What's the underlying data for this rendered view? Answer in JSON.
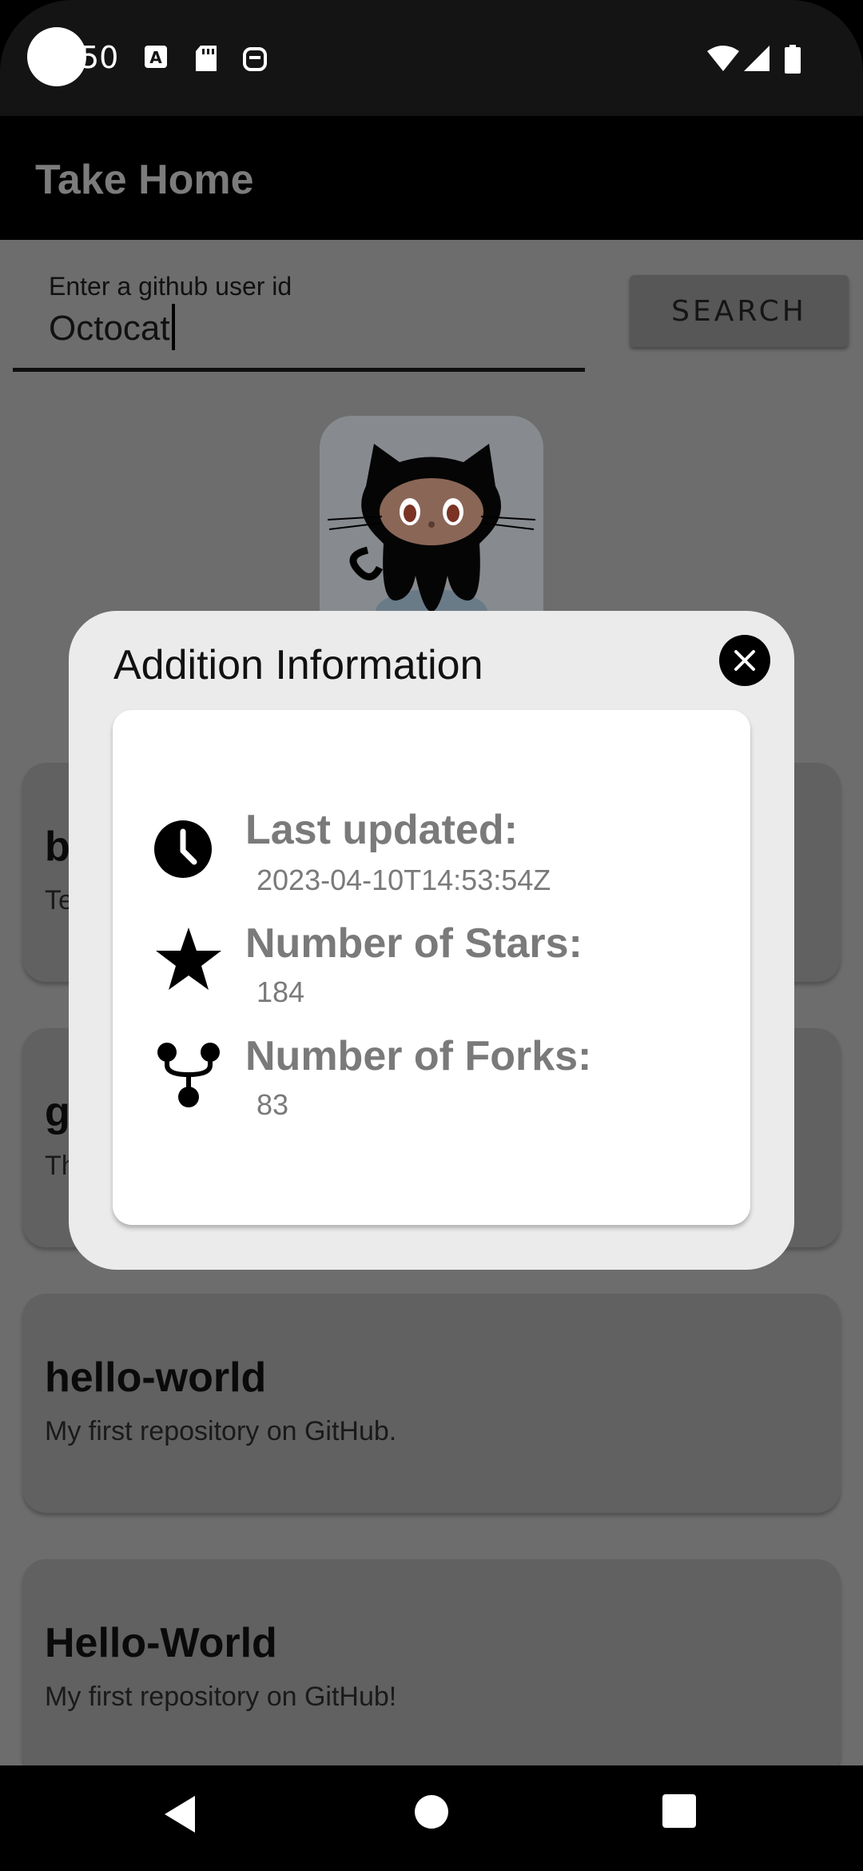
{
  "status_bar": {
    "time": "50",
    "icons": [
      "text-a-icon",
      "sd-card-icon",
      "vpn-icon",
      "wifi-icon",
      "cellular-icon",
      "battery-icon"
    ]
  },
  "app_bar": {
    "title": "Take Home"
  },
  "search": {
    "label": "Enter a github user id",
    "value": "Octocat",
    "button_label": "SEARCH"
  },
  "repos": [
    {
      "name": "b",
      "description": "Te"
    },
    {
      "name": "g",
      "description": "Th"
    },
    {
      "name": "hello-world",
      "description": "My first repository on GitHub."
    },
    {
      "name": "Hello-World",
      "description": "My first repository on GitHub!"
    }
  ],
  "dialog": {
    "title": "Addition Information",
    "last_updated_label": "Last updated:",
    "last_updated_value": "2023-04-10T14:53:54Z",
    "stars_label": "Number of Stars:",
    "stars_value": "184",
    "forks_label": "Number of Forks:",
    "forks_value": "83"
  },
  "nav": {
    "icons": [
      "back-icon",
      "home-icon",
      "recents-icon"
    ]
  },
  "colors": {
    "scrim": "#6d6d6d",
    "dialog_bg": "#ebebeb",
    "label_gray": "#7a7a7a"
  }
}
